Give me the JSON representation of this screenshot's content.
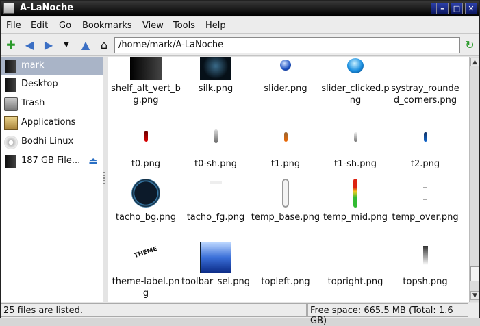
{
  "window": {
    "title": "A-LaNoche",
    "minimize": "–",
    "maximize": "□",
    "close": "✕"
  },
  "menu": [
    "File",
    "Edit",
    "Go",
    "Bookmarks",
    "View",
    "Tools",
    "Help"
  ],
  "toolbar": {
    "path": "/home/mark/A-LaNoche"
  },
  "sidebar": [
    {
      "label": "mark",
      "icon": "drive-icon"
    },
    {
      "label": "Desktop",
      "icon": "drive-icon"
    },
    {
      "label": "Trash",
      "icon": "trash-icon"
    },
    {
      "label": "Applications",
      "icon": "applications-icon"
    },
    {
      "label": "Bodhi Linux",
      "icon": "disc-icon"
    },
    {
      "label": "187 GB File...",
      "icon": "drive-icon"
    }
  ],
  "files": [
    {
      "name": "shelf_alt_vert_bg.png"
    },
    {
      "name": "silk.png"
    },
    {
      "name": "slider.png"
    },
    {
      "name": "slider_clicked.png"
    },
    {
      "name": "systray_rounded_corners.png"
    },
    {
      "name": "t0.png"
    },
    {
      "name": "t0-sh.png"
    },
    {
      "name": "t1.png"
    },
    {
      "name": "t1-sh.png"
    },
    {
      "name": "t2.png"
    },
    {
      "name": "tacho_bg.png"
    },
    {
      "name": "tacho_fg.png"
    },
    {
      "name": "temp_base.png"
    },
    {
      "name": "temp_mid.png"
    },
    {
      "name": "temp_over.png"
    },
    {
      "name": "theme-label.png"
    },
    {
      "name": "toolbar_sel.png"
    },
    {
      "name": "topleft.png"
    },
    {
      "name": "topright.png"
    },
    {
      "name": "topsh.png"
    }
  ],
  "theme_label_text": "THEME",
  "status": {
    "left": "25 files are listed.",
    "right": "Free space: 665.5 MB (Total: 1.6 GB)"
  },
  "colors": {
    "selection": "#a9b4c7",
    "titlebar": "#000000",
    "window_buttons": "#1c2a8a"
  }
}
